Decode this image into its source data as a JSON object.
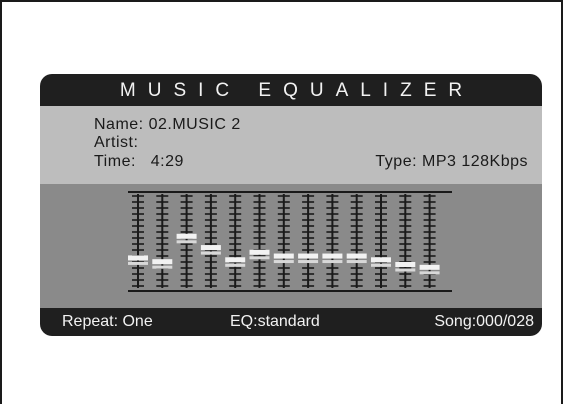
{
  "title": "MUSIC EQUALIZER",
  "info": {
    "name": "Name: 02.MUSIC 2",
    "artist": "Artist:",
    "time": "Time:   4:29",
    "type": "Type: MP3 128Kbps"
  },
  "equalizer": {
    "bands": 13,
    "levels": [
      0.32,
      0.28,
      0.55,
      0.43,
      0.3,
      0.38,
      0.34,
      0.34,
      0.34,
      0.34,
      0.3,
      0.25,
      0.22
    ]
  },
  "status": {
    "repeat": "Repeat: One",
    "eq": "EQ:standard",
    "song": "Song:000/028"
  },
  "colors": {
    "panel": "#1f1f1f",
    "info_bg": "#bdbdbd",
    "eq_bg": "#8a8a8a"
  }
}
